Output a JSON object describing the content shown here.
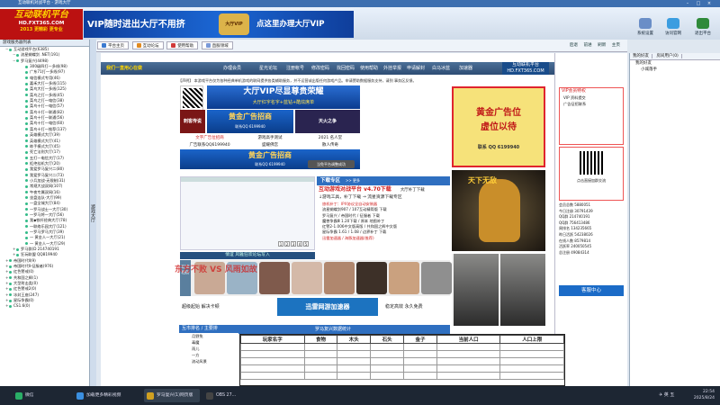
{
  "window": {
    "title": "互动联机对战平台 - 游戏大厅"
  },
  "logo": {
    "title": "互动联机平台",
    "url": "HD.FXT365.COM",
    "slogan": "2013 更精彩 更专业"
  },
  "banner": {
    "text_left": "VIP随时进出大厅不用挤",
    "text_right": "点这里办理大厅VIP",
    "crest": "大厅VIP"
  },
  "toolbar": [
    {
      "label": "系统设置",
      "color": "#6a8ec7"
    },
    {
      "label": "访问官网",
      "color": "#3b9de0"
    },
    {
      "label": "退出平台",
      "color": "#2f8a3a"
    }
  ],
  "left_panel": {
    "header": "游戏服务器列表",
    "items": [
      {
        "level": 0,
        "label": "互动游戏平台(6385)"
      },
      {
        "level": 1,
        "label": "流星蝴蝶剑 .NET(191)"
      },
      {
        "level": 1,
        "label": "罗马复兴(4498)"
      },
      {
        "level": 2,
        "label": "300级四打一多线(98)"
      },
      {
        "level": 2,
        "label": "广东71打一多线(97)"
      },
      {
        "level": 2,
        "label": "电信模式专用(46)"
      },
      {
        "level": 2,
        "label": "嘉禾大打一多线(115)"
      },
      {
        "level": 2,
        "label": "菜鸟大打一多线(125)"
      },
      {
        "level": 2,
        "label": "菜鸟之打一多线(45)"
      },
      {
        "level": 2,
        "label": "菜鸟之打一电信(38)"
      },
      {
        "level": 2,
        "label": "菜鸟十打一电信(57)"
      },
      {
        "level": 2,
        "label": "菜鸟十打一联通(82)"
      },
      {
        "level": 2,
        "label": "菜鸟十打一联通(56)"
      },
      {
        "level": 2,
        "label": "菜鸟十打一电信(60)"
      },
      {
        "level": 2,
        "label": "菜鸟十打一推荐(137)"
      },
      {
        "level": 2,
        "label": "英雄模式大厅(39)"
      },
      {
        "level": 2,
        "label": "英雄模式大厅(41)"
      },
      {
        "level": 2,
        "label": "练手模式大厅(45)"
      },
      {
        "level": 2,
        "label": "死亡法则大厅(17)"
      },
      {
        "level": 2,
        "label": "五打一电信大厅(17)"
      },
      {
        "level": 2,
        "label": "拒绝挂机大厅(20)"
      },
      {
        "level": 2,
        "label": "我爱罗马复兴二(80)"
      },
      {
        "level": 2,
        "label": "我爱罗马复兴二(73)"
      },
      {
        "level": 2,
        "label": "小兵加战-无限制(31)"
      },
      {
        "level": 2,
        "label": "常规大战双网(107)"
      },
      {
        "level": 2,
        "label": "午夜专属双网(16)"
      },
      {
        "level": 2,
        "label": "坐盘连队-大厅(99)"
      },
      {
        "level": 2,
        "label": "一盘全城大厅(84)"
      },
      {
        "level": 2,
        "label": "一罗马战士一大厅(30)"
      },
      {
        "level": 2,
        "label": "一罗马将一大厅(56)"
      },
      {
        "level": 2,
        "label": "我◆铁杆经典大厅(78)"
      },
      {
        "level": 2,
        "label": "一联络乐园大厅(121)"
      },
      {
        "level": 2,
        "label": "一罗马罗马大厅(39)"
      },
      {
        "level": 2,
        "label": "一 黄金人一大厅(21)"
      },
      {
        "level": 2,
        "label": "一 黄金人一大厅(29)"
      },
      {
        "level": 1,
        "label": "罗马群(D 214740191"
      },
      {
        "level": 1,
        "label": "狂玩联盟 QQ819940"
      },
      {
        "level": 0,
        "label": "帝国时代Ⅱ(9)"
      },
      {
        "level": 0,
        "label": "帝国时代Ⅱ-征服者(976)"
      },
      {
        "level": 0,
        "label": "红色警戒(0)"
      },
      {
        "level": 0,
        "label": "共和国之辉(1)"
      },
      {
        "level": 0,
        "label": "大型射击类(0)"
      },
      {
        "level": 0,
        "label": "红色警戒2(0)"
      },
      {
        "level": 0,
        "label": "冰封王座(247)"
      },
      {
        "level": 0,
        "label": "星际争霸(0)"
      },
      {
        "level": 0,
        "label": "CS1.6(0)"
      }
    ]
  },
  "side_strip": "游戏大厅",
  "nav_tabs": [
    {
      "label": "平台主页",
      "color": "#3b7ad0"
    },
    {
      "label": "互动论坛",
      "color": "#e08a20"
    },
    {
      "label": "使用帮助",
      "color": "#d03a3a"
    },
    {
      "label": "直服领域",
      "color": "#7a9ad8"
    }
  ],
  "browser_nav": {
    "back": "后退",
    "forward": "前进",
    "refresh": "刷新",
    "home": "主页"
  },
  "web": {
    "menu_brand": "我们一直用心在做",
    "menu": [
      "办理会员",
      "星光论坛",
      "注册帐号",
      "修改密码",
      "找回密码",
      "使用帮助",
      "外挂举报",
      "申请解封",
      "白马冰蓝",
      "加速器"
    ],
    "site_logo": "互动联机平台 HD.FXT365.COM",
    "notice": "【声明】 本游戏平台仅为各种经典单机游戏的联网提供各类辅助服务，并不运营或出版任何游戏产品。申请赞助数据服务支持，请到 事务区反馈。",
    "qr_text": [
      "互动专平",
      "微信号",
      "扫码关注"
    ],
    "vip_title": "大厅VIP尽显尊贵荣耀",
    "vip_sub": "大厅红字名字+蓝钻+酷炫席单",
    "game_btn1": "刺客传说",
    "ad_gold1": "黄金广告招商",
    "ad_gold1_sub": "联系QQ 6199940",
    "game_btn2": "天火之争",
    "links": [
      "文字广告位招商",
      "游戏高手测试",
      "2021 名人堂",
      "广告联系QQ6199940",
      "盛耀佛宫",
      "散人传奇",
      "好传奇"
    ],
    "ad_gold2": "黄金广告招商",
    "ad_gold2_sub": "联系QQ 6199940",
    "tooltip": "当免平台调整成功",
    "dl_header": "下载专区",
    "dl_more": ">> 更多",
    "dl_big": "互动游戏对战平台 v4.70下载",
    "dl_big_btn": "大厅补丁下载",
    "dl_sub": "↓游戏工具，补丁下载    → 流星资源下载专区",
    "dl_items": [
      "旅机补丁：IPX协议全自动安装器",
      "流星蝴蝶剑907 / 107互动精简版 下载",
      "罗马复兴 / 帝国时代 / 征服者 下载",
      "魔兽争霸Ⅲ 1.20下载 / 原本 地图补丁",
      "红警2-1.006中文版高版 / 共和国之辉中文版",
      "星际争霸 1.61 / 1.08 / 边界补丁 下载",
      "迅雷加速器 / 海豚加速器(推荐)"
    ],
    "shot_pages": [
      "1",
      "2",
      "3",
      "4",
      "5"
    ],
    "caption": "情谊 风雅狂欢论坛写入",
    "photo_side": "玩家相册",
    "speed_left": "超级起始 解决卡顿",
    "speed_mid": "迅雷网游加速器",
    "speed_right": "稳定高效 永久免费",
    "vs_text": "东方不败 VS 风雨如故",
    "bottom_left": "互市排名 / 主要排",
    "bottom_right": "罗马复兴数据统计",
    "side_ad1": "黄金广告位",
    "side_ad1b": "虚位以待",
    "side_ad1_phone": "联系 QQ 6199940",
    "side_ad2": "天下无敌",
    "ranking": [
      "月野兔",
      "毒魔",
      "雨儿",
      "一方",
      "流动风景"
    ]
  },
  "right_panel": {
    "vip_head": "VIP会员特权",
    "vip_items": [
      "VIP  资料提交",
      "广告征招联系"
    ],
    "qr_caption": "点击直接加群交流",
    "stats": [
      "会员总数 5880051",
      "今日注册 30791439",
      "QQ群 214740191",
      "QQ群 756413486",
      "周排名 134235665",
      "昨日活跃 54238026",
      "在线人数 8579814",
      "活跃率 240050545",
      "总注册 49084314"
    ],
    "kefu": "客服中心"
  },
  "far_right": {
    "tabs": [
      "我的好友",
      "房间用户(0)"
    ],
    "items": [
      "我的好友",
      "小城落手"
    ]
  },
  "stats_table": {
    "headers": [
      "玩家名字",
      "食物",
      "木头",
      "石头",
      "金子",
      "当前人口",
      "人口上限"
    ],
    "rows": 5
  },
  "taskbar": {
    "items": [
      {
        "label": "微信",
        "color": "#2aae67"
      },
      {
        "label": "加载更多精彩视频",
        "color": "#3b8fe0"
      },
      {
        "label": "罗马复兴(1)网页版",
        "color": "#d0a020"
      },
      {
        "label": "OBS 27...",
        "color": "#444"
      }
    ],
    "tray": "✈  英  五",
    "time": "22:54",
    "date": "2025/8/24"
  }
}
